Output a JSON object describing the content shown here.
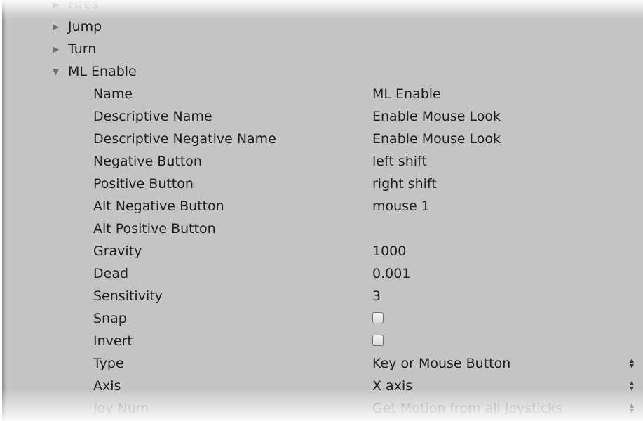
{
  "tree": {
    "items": [
      {
        "label": "Fires",
        "expanded": false
      },
      {
        "label": "Jump",
        "expanded": false
      },
      {
        "label": "Turn",
        "expanded": false
      },
      {
        "label": "ML Enable",
        "expanded": true
      }
    ]
  },
  "icons": {
    "collapsed": "triangle-right-icon",
    "expanded": "triangle-down-icon",
    "dropdown": "up-down-arrows-icon"
  },
  "properties": {
    "name": {
      "label": "Name",
      "value": "ML Enable"
    },
    "descriptive_name": {
      "label": "Descriptive Name",
      "value": "Enable Mouse Look"
    },
    "descriptive_negative_name": {
      "label": "Descriptive Negative Name",
      "value": "Enable Mouse Look"
    },
    "negative_button": {
      "label": "Negative Button",
      "value": "left shift"
    },
    "positive_button": {
      "label": "Positive Button",
      "value": "right shift"
    },
    "alt_negative_button": {
      "label": "Alt Negative Button",
      "value": "mouse 1"
    },
    "alt_positive_button": {
      "label": "Alt Positive Button",
      "value": ""
    },
    "gravity": {
      "label": "Gravity",
      "value": "1000"
    },
    "dead": {
      "label": "Dead",
      "value": "0.001"
    },
    "sensitivity": {
      "label": "Sensitivity",
      "value": "3"
    },
    "snap": {
      "label": "Snap",
      "checked": false
    },
    "invert": {
      "label": "Invert",
      "checked": false
    },
    "type": {
      "label": "Type",
      "value": "Key or Mouse Button"
    },
    "axis": {
      "label": "Axis",
      "value": "X axis"
    },
    "joy_num": {
      "label": "Joy Num",
      "value": "Get Motion from all Joysticks"
    }
  },
  "colors": {
    "panel_bg": "#c4c4c4",
    "text": "#1e1e1e",
    "arrow": "#6e6e6e"
  }
}
